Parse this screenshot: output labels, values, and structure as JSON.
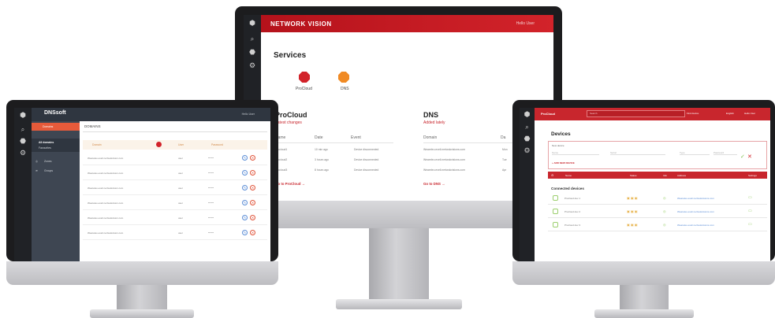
{
  "center": {
    "brand": "NETWORK VISION",
    "user": "Hello User",
    "title": "Services",
    "services": [
      {
        "name": "ProCloud",
        "color": "#d2232a"
      },
      {
        "name": "DNS",
        "color": "#f08a24"
      }
    ],
    "procloud": {
      "title": "ProCloud",
      "subtitle": "Latest changes",
      "headers": [
        "Name",
        "Date",
        "Event"
      ],
      "rows": [
        [
          "Procloud1",
          "10 min ago",
          "Device disconnected"
        ],
        [
          "Procloud2",
          "3 hours ago",
          "Device disconnected"
        ],
        [
          "Procloud3",
          "8 hours ago",
          "Device disconnected"
        ]
      ],
      "link": "Go to ProCloud →"
    },
    "dns": {
      "title": "DNS",
      "subtitle": "Added lately",
      "headers": [
        "Domain",
        "Da"
      ],
      "rows": [
        [
          "Weareleo.exeli.nertwokvisions.com",
          "Mon"
        ],
        [
          "Weareleo.exeli.nertwokvisions.com",
          "Tue"
        ],
        [
          "Weareleo.exeli.nertwokvisions.com",
          "Apr"
        ]
      ],
      "link": "Go to DNS →"
    }
  },
  "left": {
    "logo": "DNSsoft",
    "user": "Hello User",
    "nav_top": "Domains",
    "nav_sub1": "All domains",
    "nav_sub2": "Favourites",
    "nav_zones": "Zones",
    "nav_groups": "Groups",
    "header": "DOMAINS",
    "columns": [
      "Domain",
      "User",
      "Password"
    ],
    "rows": [
      {
        "domain": "Weareleo.exeli.nertwokvision.com",
        "user": "user",
        "pass": "******"
      },
      {
        "domain": "Weareleo.exeli.nertwokvision.com",
        "user": "user",
        "pass": "******"
      },
      {
        "domain": "Weareleo.exeli.nertwokvision.com",
        "user": "user",
        "pass": "******"
      },
      {
        "domain": "Weareleo.exeli.nertwokvision.com",
        "user": "user",
        "pass": "******"
      },
      {
        "domain": "Weareleo.exeli.nertwokvision.com",
        "user": "user",
        "pass": "******"
      },
      {
        "domain": "Weareleo.exeli.nertwokvision.com",
        "user": "user",
        "pass": "******"
      }
    ]
  },
  "right": {
    "brand": "ProCloud",
    "search_placeholder": "Search",
    "search_btn": "Find device",
    "lang": "English",
    "user": "Hello User",
    "title": "Devices",
    "add_label": "New device",
    "add_fields": [
      "Name",
      "Serial",
      "Type",
      "Password"
    ],
    "add_link": "+ ADD NEW DEVICE",
    "list_cols": [
      "Name",
      "Status",
      "Info",
      "Address",
      "Settings"
    ],
    "connected": "Connected devices",
    "devices": [
      {
        "name": "Procloud dev 1",
        "address": "Weareleo.exeli.nertwokvisions.com"
      },
      {
        "name": "Procloud dev 2",
        "address": "Weareleo.exeli.nertwokvisions.com"
      },
      {
        "name": "Procloud dev 3",
        "address": "Weareleo.exeli.nertwokvisions.com"
      }
    ]
  }
}
